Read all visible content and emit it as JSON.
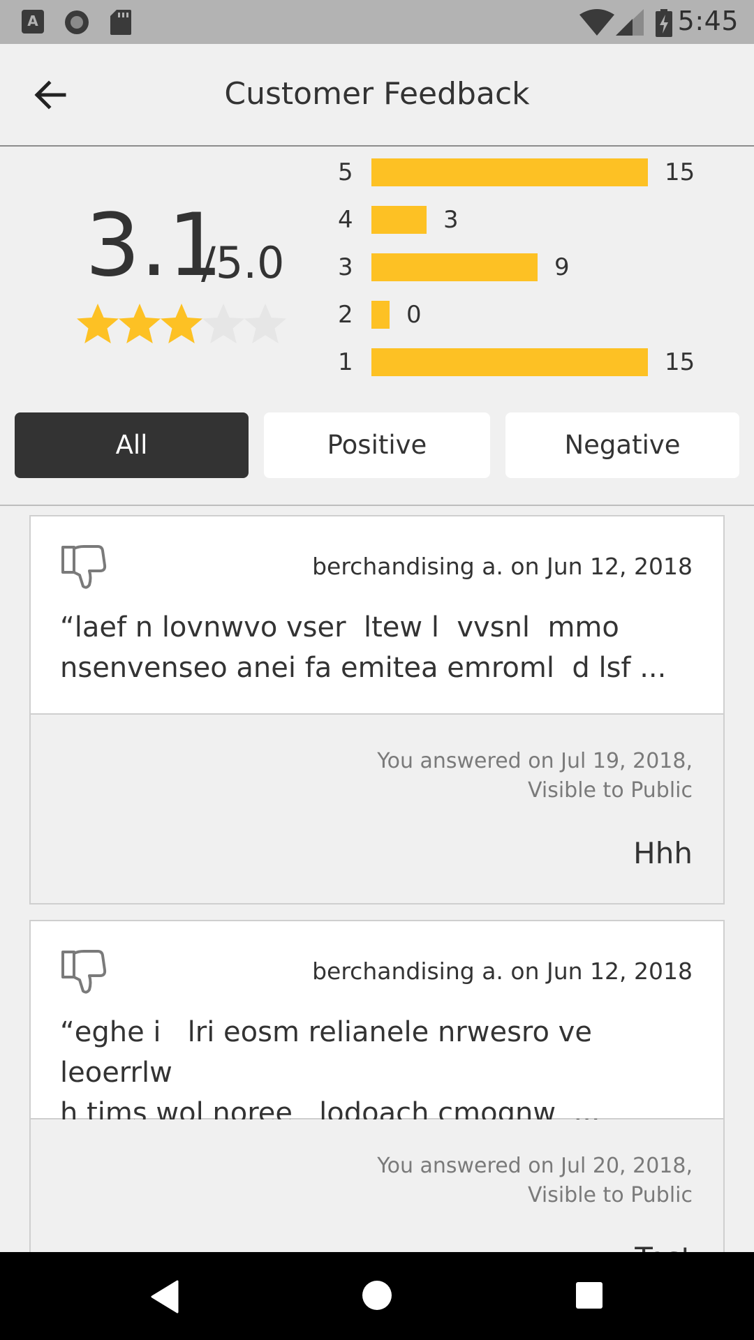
{
  "status_bar": {
    "time": "5:45",
    "icons": [
      "a-icon",
      "circle-icon",
      "sd-card-icon",
      "wifi-icon",
      "signal-icon",
      "battery-charging-icon"
    ]
  },
  "header": {
    "title": "Customer Feedback",
    "back_icon": "arrow-back-icon"
  },
  "summary": {
    "score": "3.1",
    "max": "/5.0",
    "stars_filled": 3,
    "stars_total": 5,
    "star_color": "#fdc124",
    "star_empty_color": "#e6e6e6",
    "distribution": [
      {
        "label": "5",
        "count": "15",
        "value": 15
      },
      {
        "label": "4",
        "count": "3",
        "value": 3
      },
      {
        "label": "3",
        "count": "9",
        "value": 9
      },
      {
        "label": "2",
        "count": "0",
        "value": 0
      },
      {
        "label": "1",
        "count": "15",
        "value": 15
      }
    ]
  },
  "filters": [
    {
      "label": "All",
      "active": true
    },
    {
      "label": "Positive",
      "active": false
    },
    {
      "label": "Negative",
      "active": false
    }
  ],
  "reviews": [
    {
      "sentiment_icon": "thumbs-down-icon",
      "meta": "berchandising a. on Jun 12, 2018",
      "text": "“laef n lovnwvo vser  ltew l  vvsnl  mmo\nnsenvenseo anei fa emitea emroml  d lsf ...",
      "answer_meta_1": "You answered on Jul 19, 2018,",
      "answer_meta_2": "Visible to Public",
      "answer": "Hhh"
    },
    {
      "sentiment_icon": "thumbs-down-icon",
      "meta": "berchandising a. on Jun 12, 2018",
      "text": "“eghe i   lri eosm relianele nrwesro ve leoerrlw\nh tims wol noree   lodoach cmognw  ...",
      "answer_meta_1": "You answered on Jul 20, 2018,",
      "answer_meta_2": "Visible to Public",
      "answer": "Test"
    }
  ],
  "nav": {
    "back": "nav-back-icon",
    "home": "nav-home-icon",
    "recents": "nav-recents-icon"
  }
}
